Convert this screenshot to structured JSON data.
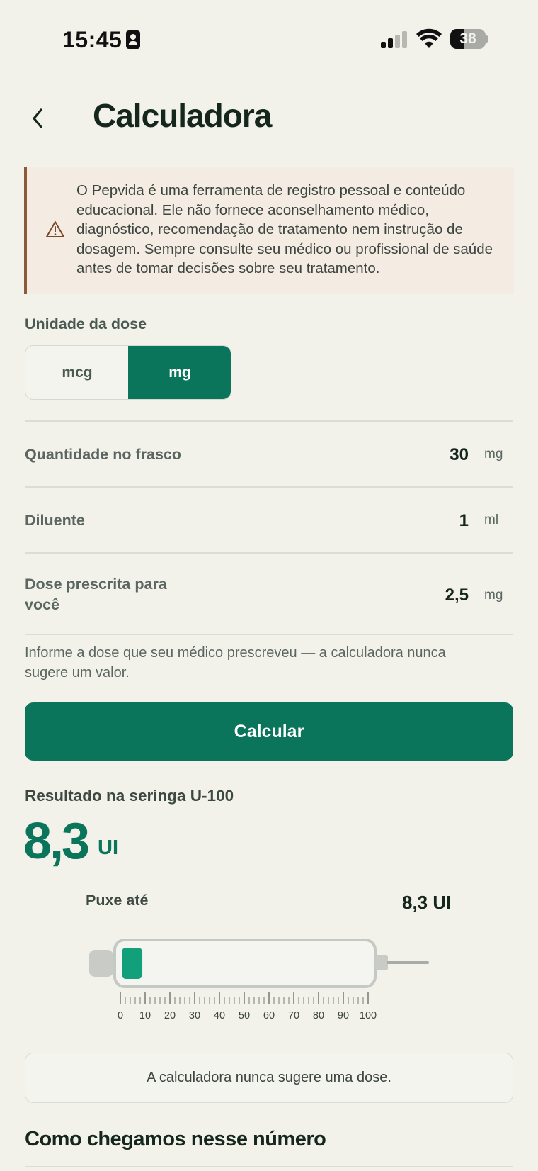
{
  "status_bar": {
    "time": "15:45",
    "battery_percent": "38",
    "battery_level": 0.38
  },
  "header": {
    "title": "Calculadora",
    "back_icon": "chevron-left-icon"
  },
  "disclaimer": {
    "icon": "warning-triangle-icon",
    "text": "O Pepvida é uma ferramenta de registro pessoal e conteúdo educacional. Ele não fornece aconselhamento médico, diagnóstico, recomendação de tratamento nem instrução de dosagem. Sempre consulte seu médico ou profissional de saúde antes de tomar decisões sobre seu tratamento."
  },
  "dose_unit": {
    "label": "Unidade da dose",
    "options": [
      "mcg",
      "mg"
    ],
    "selected": "mg"
  },
  "fields": [
    {
      "label": "Quantidade no frasco",
      "value": "30",
      "unit": "mg"
    },
    {
      "label": "Diluente",
      "value": "1",
      "unit": "ml"
    },
    {
      "label": "Dose prescrita para você",
      "value": "2,5",
      "unit": "mg"
    }
  ],
  "helper_text": "Informe a dose que seu médico prescreveu — a calculadora nunca sugere um valor.",
  "calculate_button": "Calcular",
  "result": {
    "label": "Resultado na seringa U-100",
    "value": "8,3",
    "unit": "UI",
    "pull_label": "Puxe até",
    "pull_value": "8,3 UI",
    "syringe_units": 8.3,
    "syringe_max": 100,
    "scale_labels": [
      "0",
      "10",
      "20",
      "30",
      "40",
      "50",
      "60",
      "70",
      "80",
      "90",
      "100"
    ]
  },
  "note": "A calculadora nunca sugere uma dose.",
  "how_title": "Como chegamos nesse número",
  "colors": {
    "accent": "#0a755a",
    "background": "#f2f1ea",
    "warning_border": "#8a5a3a",
    "warning_bg": "#f4ebe2"
  }
}
